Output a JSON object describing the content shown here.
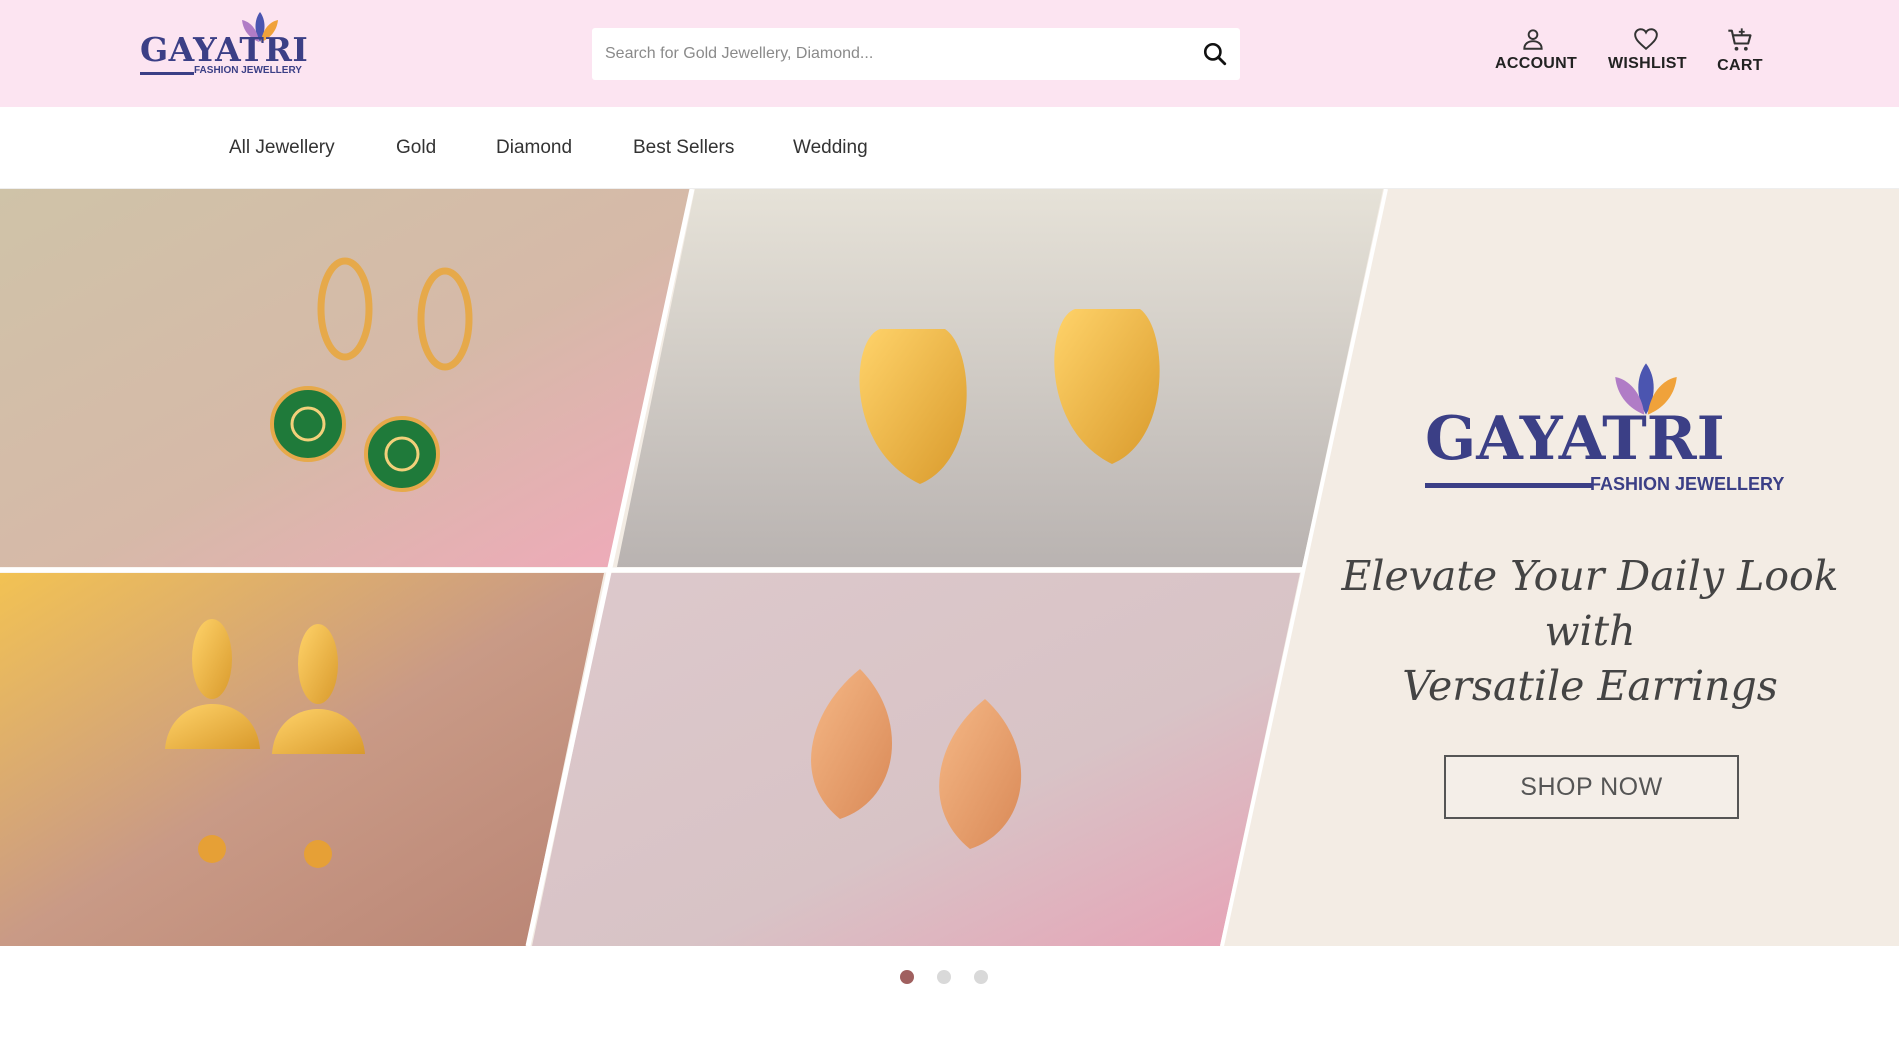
{
  "header": {
    "logo": {
      "name": "GAYATRI",
      "tagline": "FASHION JEWELLERY"
    },
    "search": {
      "placeholder": "Search for Gold Jewellery, Diamond...",
      "icon": "search-icon"
    },
    "actions": [
      {
        "label": "ACCOUNT",
        "icon": "user-icon"
      },
      {
        "label": "WISHLIST",
        "icon": "heart-icon"
      },
      {
        "label": "CART",
        "icon": "cart-icon"
      }
    ]
  },
  "nav": {
    "items": [
      "All Jewellery",
      "Gold",
      "Diamond",
      "Best Sellers",
      "Wedding"
    ]
  },
  "hero": {
    "brand_name": "GAYATRI",
    "brand_tagline": "FASHION JEWELLERY",
    "headline_line1": "Elevate Your Daily Look with",
    "headline_line2": "Versatile Earrings",
    "cta_label": "SHOP NOW"
  },
  "carousel": {
    "slides": 3,
    "active": 1
  },
  "colors": {
    "header_bg": "#fce4f1",
    "brand": "#3b3f86",
    "dot_active": "#a0605f",
    "dot_inactive": "#d9d9d9"
  }
}
